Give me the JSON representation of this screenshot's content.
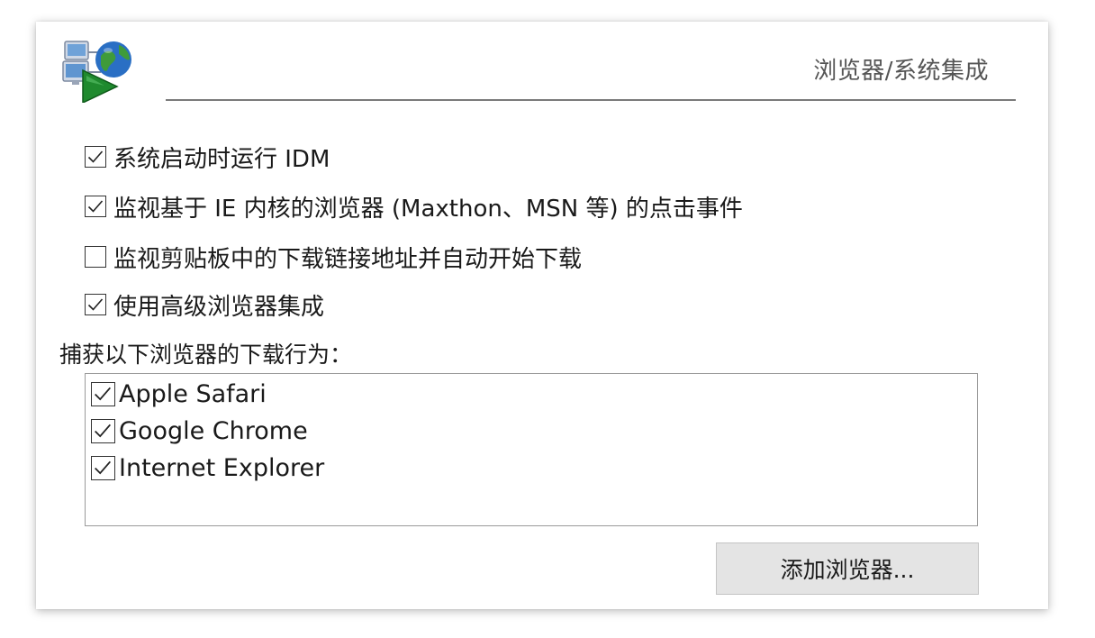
{
  "header": {
    "section_title": "浏览器/系统集成",
    "logo_icon": "idm-logo-icon"
  },
  "options": [
    {
      "label": "系统启动时运行 IDM",
      "checked": true
    },
    {
      "label": "监视基于 IE 内核的浏览器 (Maxthon、MSN 等) 的点击事件",
      "checked": true
    },
    {
      "label": "监视剪贴板中的下载链接地址并自动开始下载",
      "checked": false
    },
    {
      "label": "使用高级浏览器集成",
      "checked": true
    }
  ],
  "capture": {
    "label": "捕获以下浏览器的下载行为：",
    "browsers": [
      {
        "label": "Apple Safari",
        "checked": true
      },
      {
        "label": "Google Chrome",
        "checked": true
      },
      {
        "label": "Internet Explorer",
        "checked": true
      }
    ]
  },
  "buttons": {
    "add_browser": "添加浏览器..."
  },
  "colors": {
    "accent_green": "#1f8a2e",
    "globe_blue": "#2a6fc4",
    "button_bg": "#e4e4e4"
  }
}
